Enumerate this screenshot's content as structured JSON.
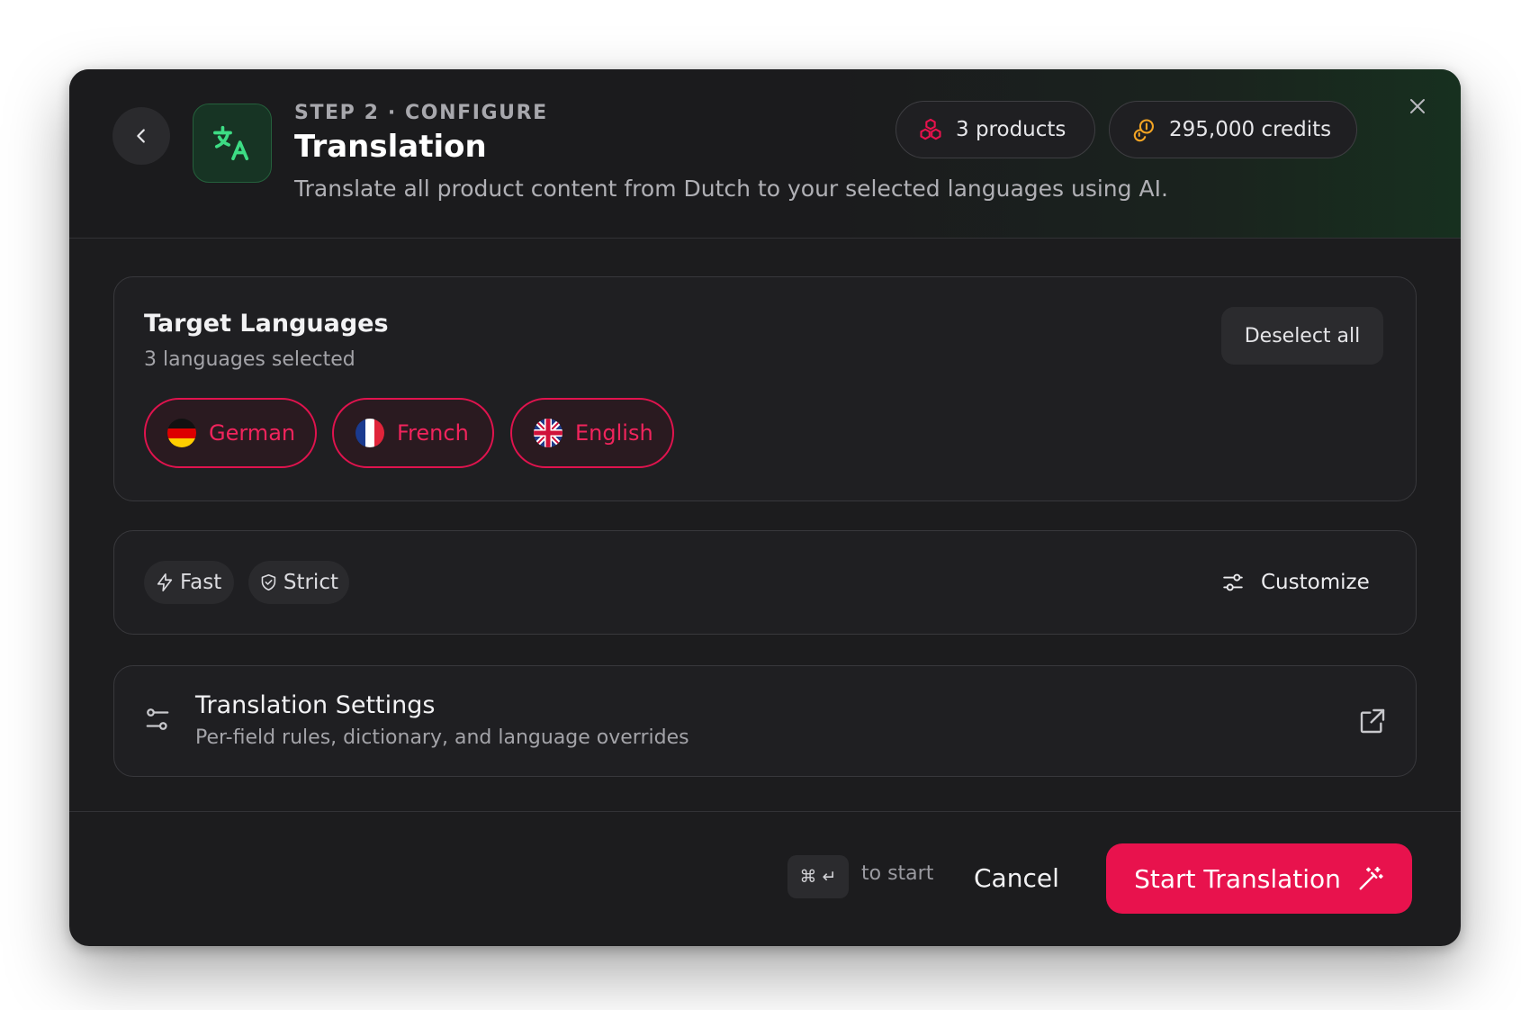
{
  "header": {
    "step_label": "STEP 2 · CONFIGURE",
    "title": "Translation",
    "subtitle": "Translate all product content from Dutch to your selected languages using AI.",
    "products_label": "3 products",
    "credits_label": "295,000 credits",
    "icons": {
      "back": "chevron-left-icon",
      "app": "translate-icon",
      "products": "cubes-icon",
      "credits": "coins-icon",
      "close": "close-icon"
    }
  },
  "languages": {
    "title": "Target Languages",
    "subtitle": "3 languages selected",
    "deselect_label": "Deselect all",
    "items": [
      {
        "label": "German",
        "flag": "de-flag-icon"
      },
      {
        "label": "French",
        "flag": "fr-flag-icon"
      },
      {
        "label": "English",
        "flag": "gb-flag-icon"
      }
    ]
  },
  "modes": {
    "items": [
      {
        "label": "Fast",
        "icon": "bolt-icon"
      },
      {
        "label": "Strict",
        "icon": "shield-check-icon"
      }
    ],
    "customize_label": "Customize"
  },
  "settings": {
    "title": "Translation Settings",
    "subtitle": "Per-field rules, dictionary, and language overrides"
  },
  "footer": {
    "shortcut_keys": [
      "⌘",
      "↵"
    ],
    "shortcut_hint": "to start",
    "cancel_label": "Cancel",
    "start_label": "Start Translation"
  },
  "colors": {
    "accent": "#e8124d",
    "chip_text": "#f0245c",
    "app_icon_green": "#3ddc84",
    "credits_gold": "#f5a524",
    "background": "#1c1c1e"
  }
}
